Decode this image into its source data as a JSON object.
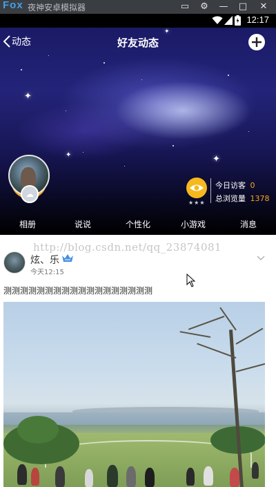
{
  "emulator": {
    "logo": "Fox",
    "title": "夜神安卓模拟器",
    "controls": [
      "▭",
      "⚙",
      "—",
      "□",
      "✕"
    ]
  },
  "status_bar": {
    "time": "12:17"
  },
  "header": {
    "back_label": "动态",
    "title": "好友动态",
    "add_icon": "plus-icon"
  },
  "profile": {
    "visitors_today_label": "今日访客",
    "visitors_today_value": "0",
    "total_views_label": "总浏览量",
    "total_views_value": "1378",
    "star_label": "★★★"
  },
  "tabs": [
    {
      "label": "相册"
    },
    {
      "label": "说说"
    },
    {
      "label": "个性化"
    },
    {
      "label": "小游戏"
    },
    {
      "label": "消息"
    }
  ],
  "post": {
    "user": "炫、乐",
    "time": "今天12:15",
    "text": "测测测测测测测测测测测测测测测测测测",
    "watermark": "http://blog.csdn.net/qq_23874081"
  },
  "colors": {
    "accent": "#f5a623",
    "vip": "#4a90e2"
  }
}
